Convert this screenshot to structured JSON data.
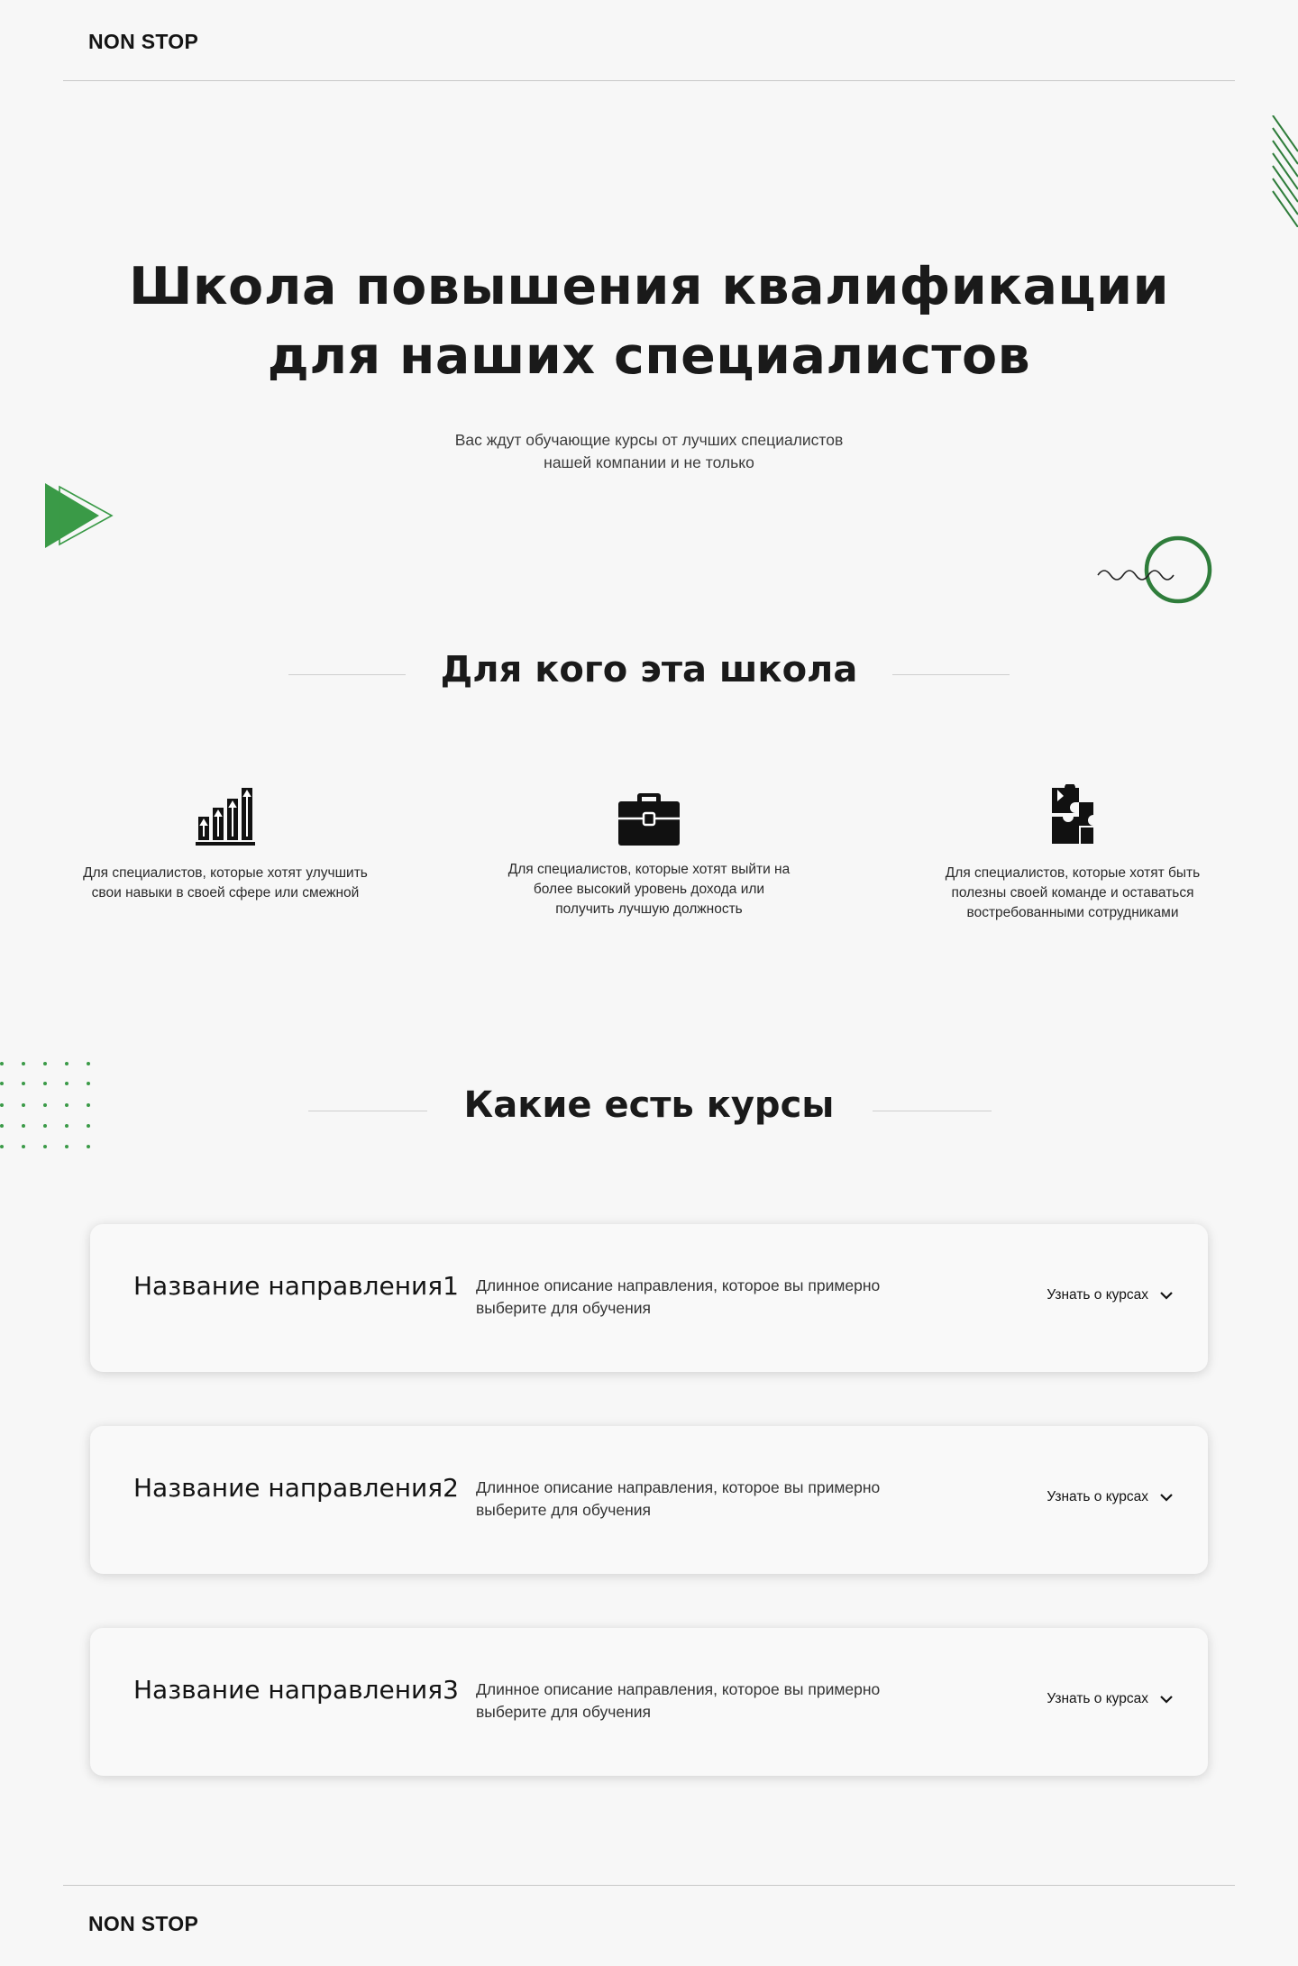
{
  "brand": "NON STOP",
  "hero": {
    "title_line1": "Школа повышения квалификации",
    "title_line2": "для наших специалистов",
    "subtitle_line1": "Вас ждут обучающие курсы от лучших специалистов",
    "subtitle_line2": "нашей компании и не только"
  },
  "audience": {
    "title": "Для кого эта школа",
    "items": [
      {
        "icon": "growth-chart-icon",
        "text": "Для специалистов, которые хотят улучшить свои навыки в своей сфере или смежной"
      },
      {
        "icon": "briefcase-icon",
        "text": "Для специалистов, которые хотят выйти на более высокий уровень дохода или получить лучшую должность"
      },
      {
        "icon": "puzzle-icon",
        "text": "Для специалистов, которые хотят быть полезны своей команде и оставаться востребованными сотрудниками"
      }
    ]
  },
  "courses": {
    "title": "Какие есть курсы",
    "items": [
      {
        "name": "Название направления1",
        "description": "Длинное описание направления, которое вы примерно выберите для обучения",
        "more_label": "Узнать о курсах"
      },
      {
        "name": "Название направления2",
        "description": "Длинное описание направления, которое вы примерно выберите для обучения",
        "more_label": "Узнать о курсах"
      },
      {
        "name": "Название направления3",
        "description": "Длинное описание направления, которое вы примерно выберите для обучения",
        "more_label": "Узнать о курсах"
      }
    ]
  },
  "footer": {
    "brand": "NON STOP"
  },
  "colors": {
    "accent": "#3a9a47",
    "accent_dark": "#2f7d3b",
    "text": "#1a1a1a",
    "background": "#f7f7f7"
  }
}
